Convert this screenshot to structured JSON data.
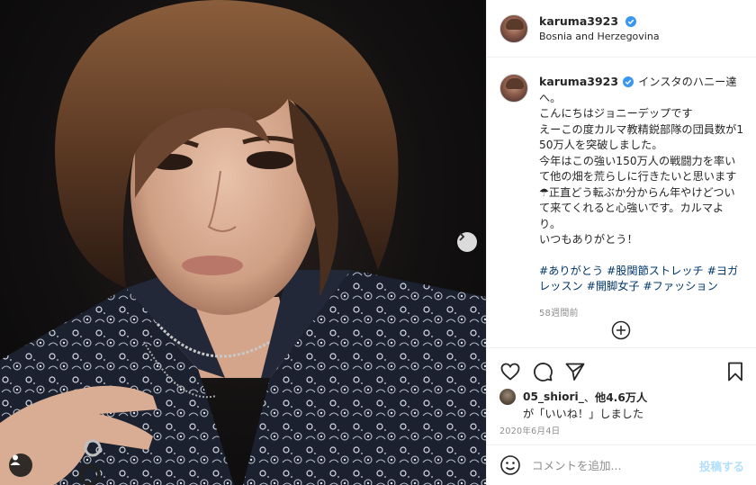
{
  "post": {
    "username": "karuma3923",
    "location": "Bosnia and Herzegovina",
    "caption_text": "インスタのハニー達へ。\nこんにちはジョニーデップです\nえーこの度カルマ教精鋭部隊の団員数が150万人を突破しました。\n今年はこの強い150万人の戦闘力を率いて他の畑を荒らしに行きたいと思います☂正直どう転ぶか分からん年やけどついて来てくれると心強いです。カルマより。\nいつもありがとう！",
    "hashtags": [
      "#ありがとう",
      "#股関節ストレッチ",
      "#ヨガレッスン",
      "#開脚女子",
      "#ファッション"
    ],
    "time_ago": "58週間前",
    "likes_user": "05_shiori_",
    "likes_sep": "、",
    "likes_count": "他4.6万人",
    "likes_suffix": "が「いいね！」しました",
    "date": "2020年6月4日"
  },
  "comment": {
    "placeholder": "コメントを追加...",
    "post_label": "投稿する"
  },
  "icons": {
    "verified": "verified-badge-icon",
    "like": "heart-icon",
    "comment": "comment-icon",
    "share": "paper-plane-icon",
    "save": "bookmark-icon",
    "more": "plus-circle-icon",
    "next": "chevron-right-icon",
    "tag": "user-tag-icon",
    "emoji": "smiley-icon"
  },
  "colors": {
    "verified": "#3897f0",
    "hashtag": "#00376b",
    "muted": "#8e8e8e",
    "post_disabled": "#b2dffc"
  }
}
